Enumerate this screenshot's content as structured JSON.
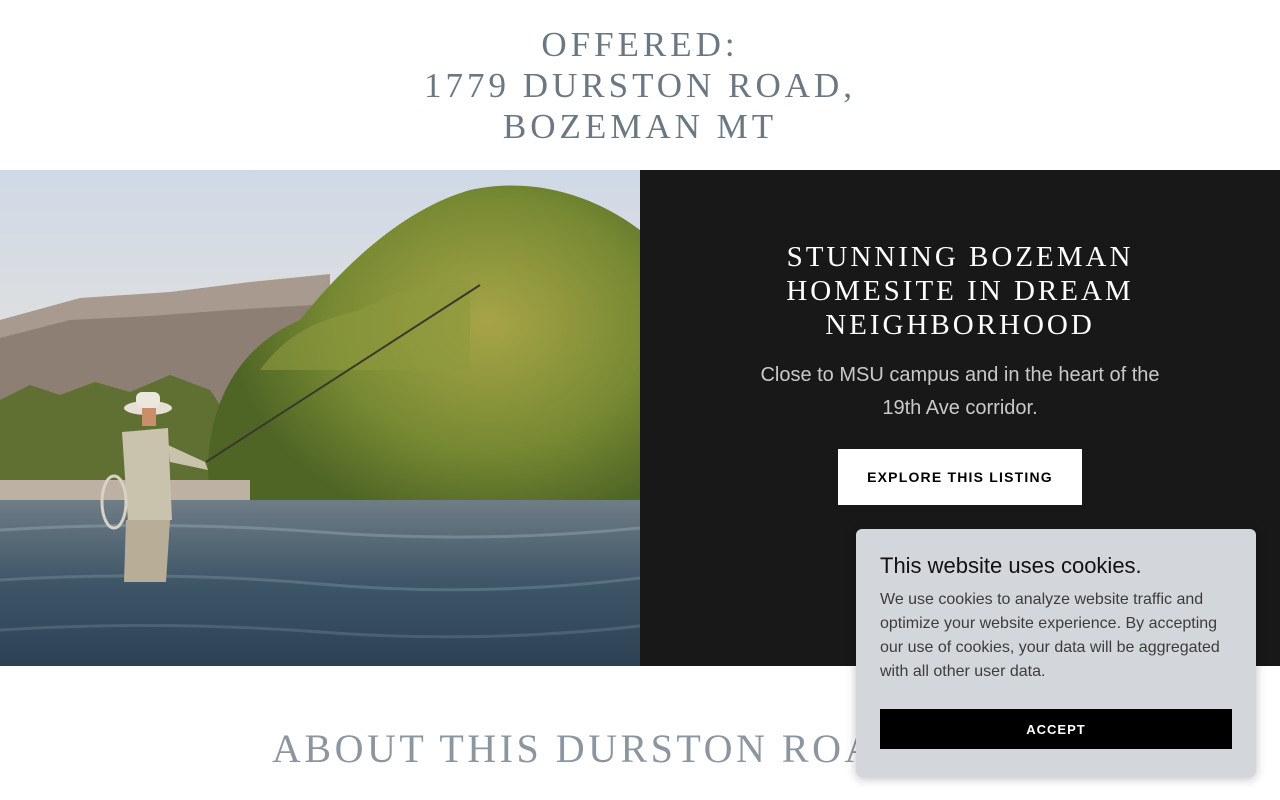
{
  "header": {
    "line1": "OFFERED:",
    "line2": "1779 DURSTON ROAD,",
    "line3": "BOZEMAN MT"
  },
  "hero": {
    "image_icon": "fly-fishing-river-photo",
    "heading": "STUNNING BOZEMAN HOMESITE IN DREAM NEIGHBORHOOD",
    "subtext": "Close to MSU campus and in the heart of the 19th Ave corridor.",
    "button_label": "EXPLORE THIS LISTING",
    "panel_color": "#181818"
  },
  "about": {
    "title": "ABOUT THIS DURSTON ROA"
  },
  "cookie_banner": {
    "title": "This website uses cookies.",
    "text": "We use cookies to analyze website traffic and optimize your website experience. By accepting our use of cookies, your data will be aggregated with all other user data.",
    "accept_label": "ACCEPT"
  }
}
